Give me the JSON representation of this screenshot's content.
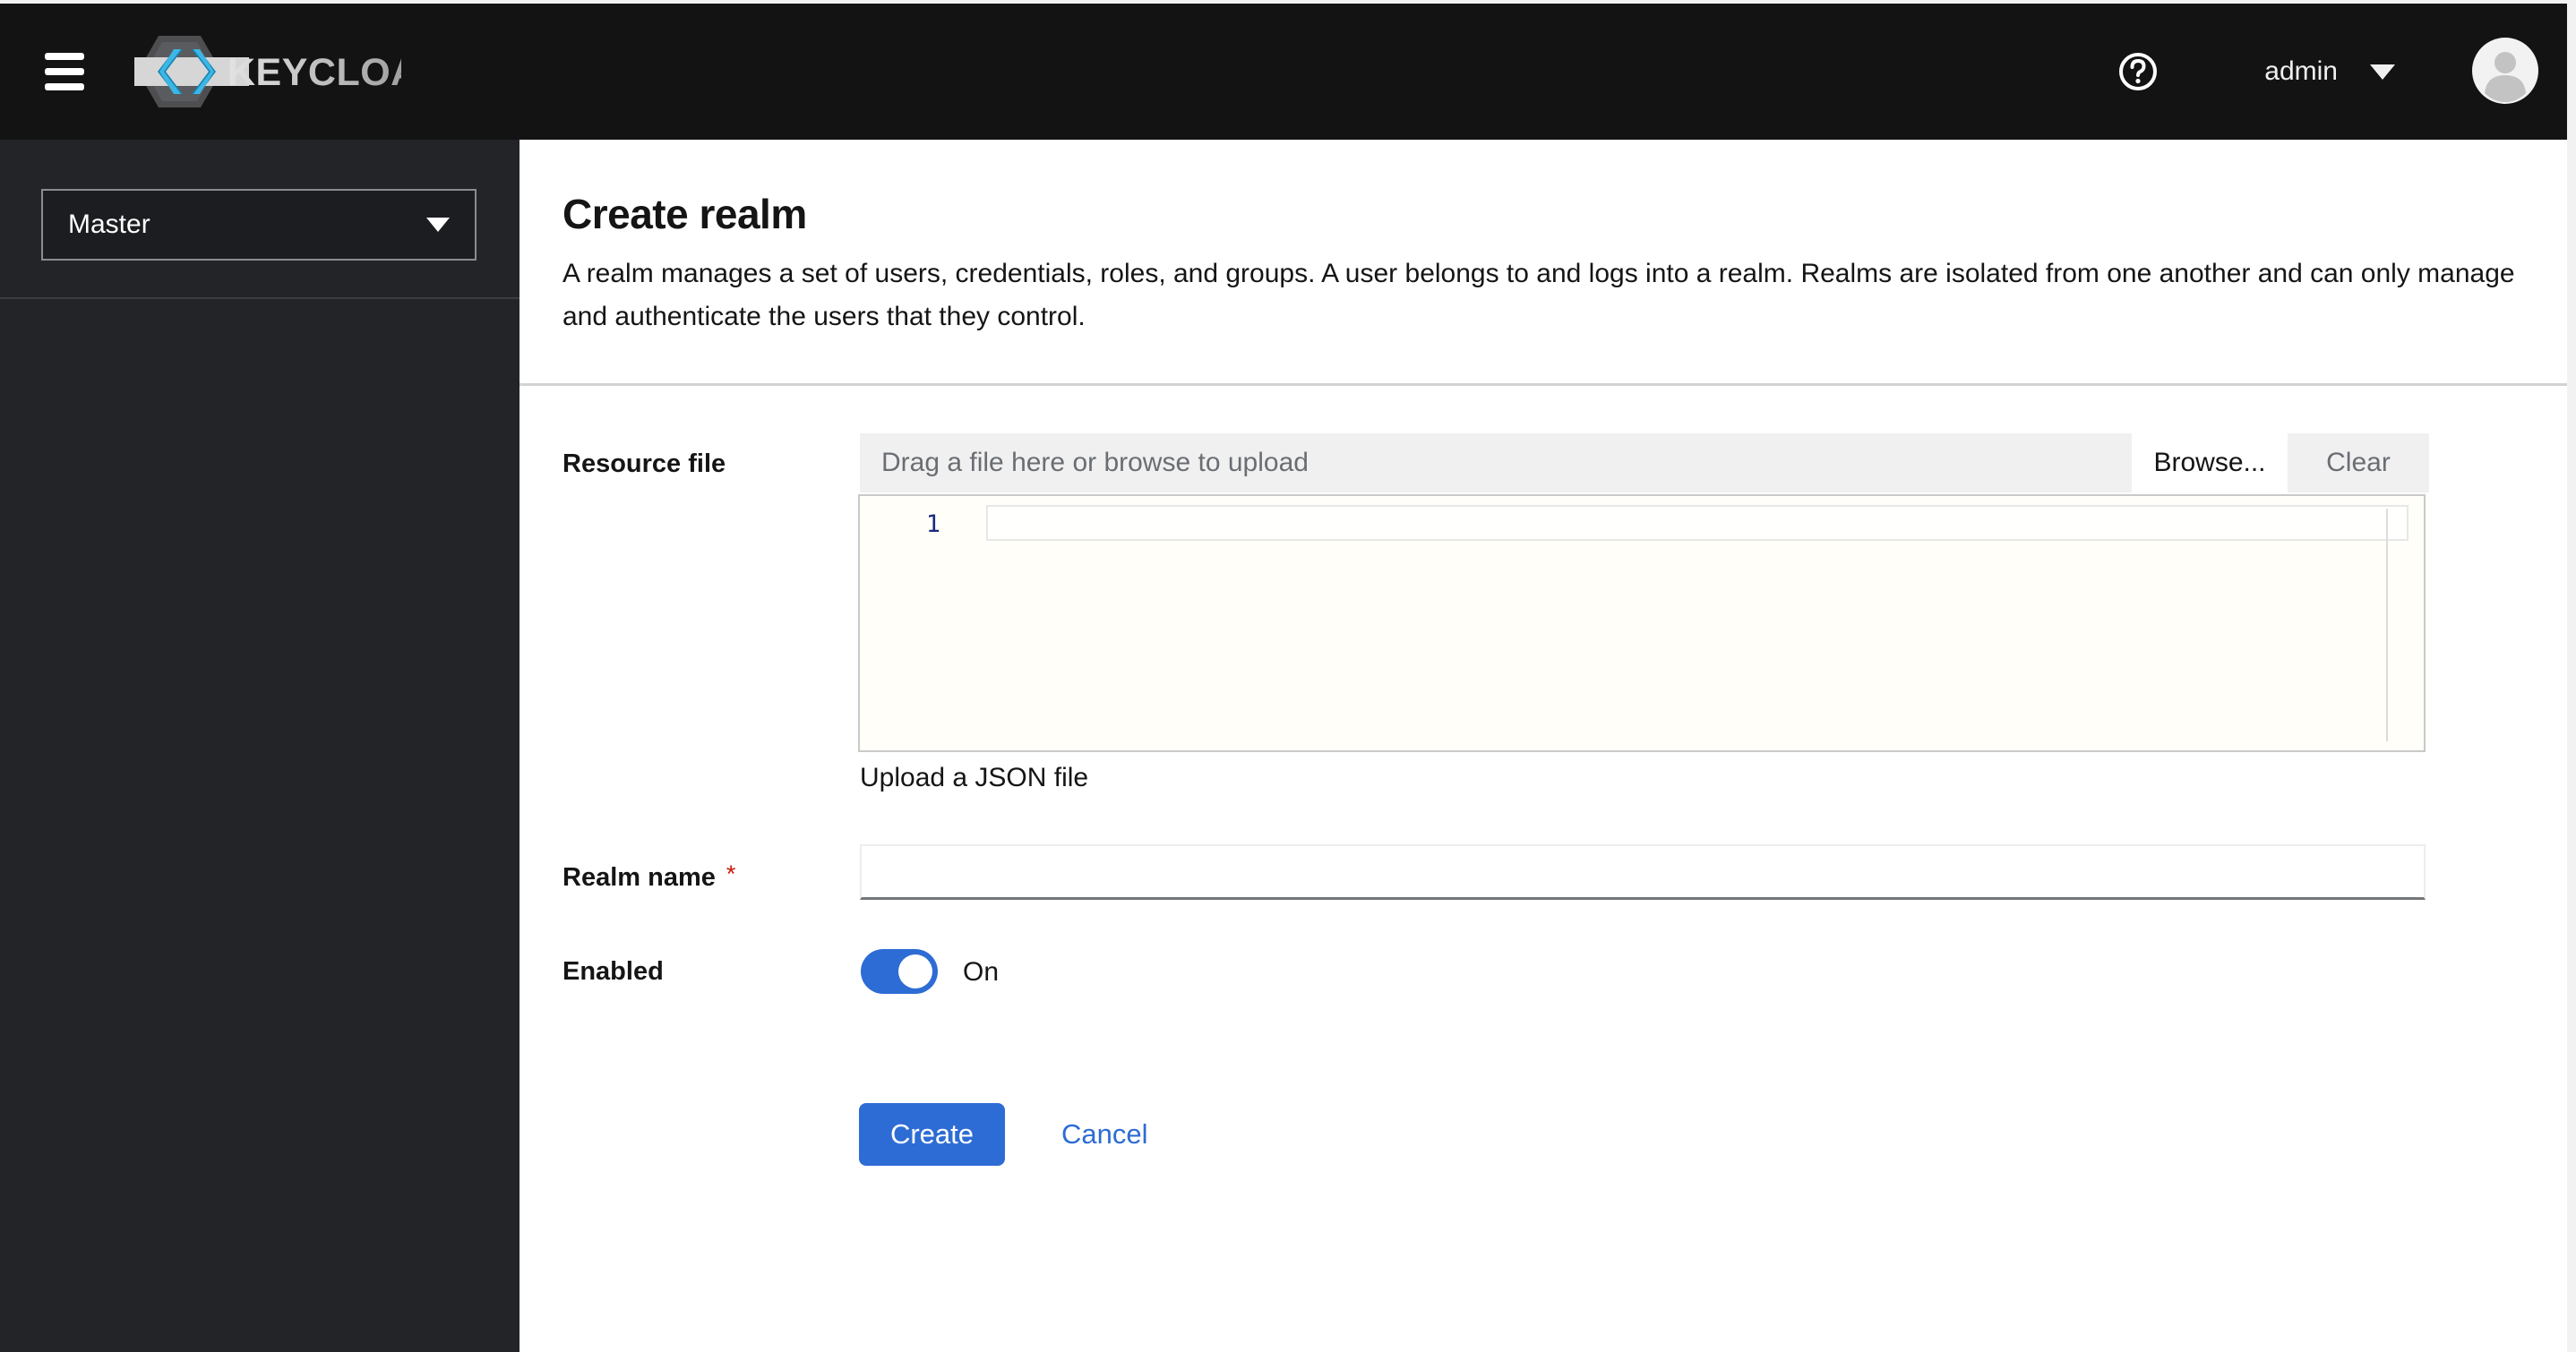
{
  "masthead": {
    "brand": "KEYCLOAK",
    "username": "admin",
    "icons": {
      "menu": "hamburger-menu",
      "help": "question-circle",
      "user_caret": "chevron-down",
      "avatar": "user-silhouette"
    }
  },
  "sidebar": {
    "realm_selector": {
      "value": "Master"
    }
  },
  "page": {
    "title": "Create realm",
    "description": "A realm manages a set of users, credentials, roles, and groups. A user belongs to and logs into a realm. Realms are isolated from one another and can only manage and authenticate the users that they control."
  },
  "form": {
    "resource_file": {
      "label": "Resource file",
      "placeholder": "Drag a file here or browse to upload",
      "browse_label": "Browse...",
      "clear_label": "Clear",
      "editor_line_number": "1",
      "helper_text": "Upload a JSON file"
    },
    "realm_name": {
      "label": "Realm name",
      "required_marker": "*",
      "value": ""
    },
    "enabled": {
      "label": "Enabled",
      "state_label": "On",
      "on": true
    },
    "actions": {
      "create_label": "Create",
      "cancel_label": "Cancel"
    }
  },
  "colors": {
    "accent": "#2d6cd4",
    "masthead_bg": "#131313",
    "sidebar_bg": "#222428",
    "required": "#c9190b",
    "muted_text": "#6a6e73"
  }
}
